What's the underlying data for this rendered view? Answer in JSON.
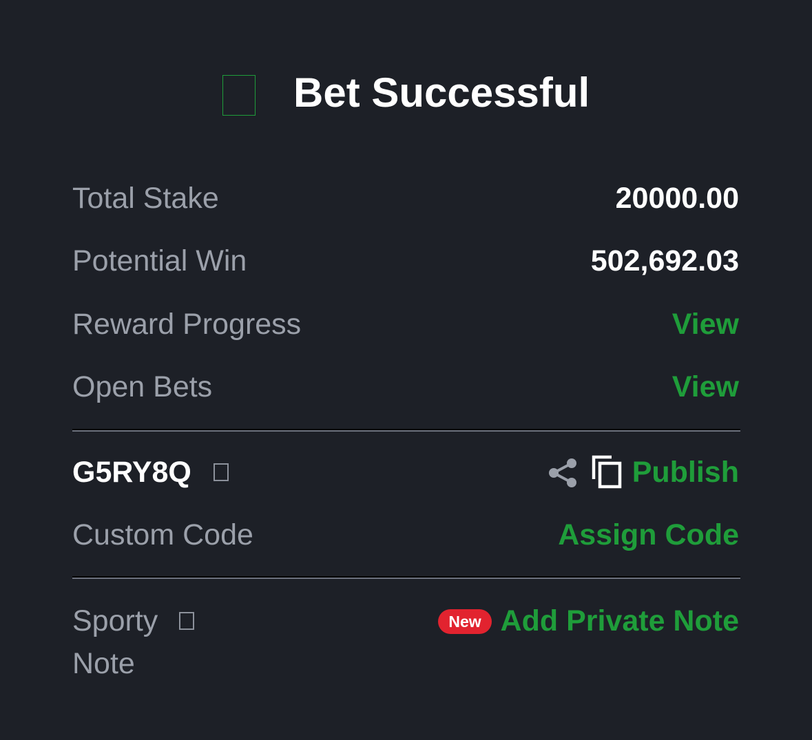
{
  "header": {
    "title": "Bet Successful",
    "status_icon": "success-checkmark-icon"
  },
  "summary": {
    "total_stake_label": "Total Stake",
    "total_stake_value": "20000.00",
    "potential_win_label": "Potential Win",
    "potential_win_value": "502,692.03",
    "reward_progress_label": "Reward Progress",
    "reward_progress_link": "View",
    "open_bets_label": "Open Bets",
    "open_bets_link": "View"
  },
  "booking": {
    "code": "G5RY8Q",
    "info_icon": "info-icon",
    "share_icon": "share-icon",
    "copy_icon": "copy-icon",
    "publish_label": "Publish",
    "custom_code_label": "Custom Code",
    "assign_code_label": "Assign Code"
  },
  "note": {
    "label_line1": "Sporty",
    "label_line2": "Note",
    "info_icon": "info-icon",
    "badge": "New",
    "add_note_label": "Add Private Note"
  },
  "colors": {
    "background": "#1d2027",
    "accent_green": "#1f9d3a",
    "badge_red": "#e2232f",
    "label_gray": "#9ba0aa",
    "value_white": "#ffffff"
  }
}
